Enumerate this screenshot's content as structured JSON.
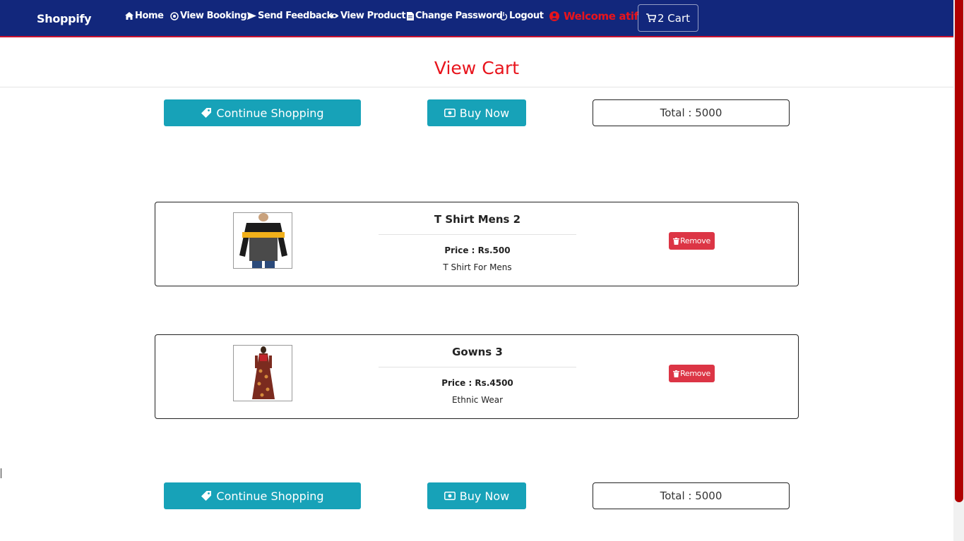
{
  "navbar": {
    "brand": "Shoppify",
    "items": [
      {
        "label": "Home",
        "icon": "home-icon"
      },
      {
        "label": "View Booking",
        "icon": "booking-icon"
      },
      {
        "label": "Send Feedback",
        "icon": "send-icon"
      },
      {
        "label": "View Product",
        "icon": "eye-icon"
      },
      {
        "label": "Change Password",
        "icon": "document-icon"
      },
      {
        "label": "Logout",
        "icon": "power-icon"
      }
    ],
    "welcome": "Welcome atif",
    "cart_label": "2 Cart"
  },
  "page": {
    "title": "View Cart"
  },
  "actions": {
    "continue_label": "Continue Shopping",
    "buy_label": "Buy Now",
    "total_label": "Total : 5000"
  },
  "cart_items": [
    {
      "name": "T Shirt Mens 2",
      "price": "Price : Rs.500",
      "description": "T Shirt For Mens",
      "remove_label": "Remove"
    },
    {
      "name": "Gowns 3",
      "price": "Price : Rs.4500",
      "description": "Ethnic Wear",
      "remove_label": "Remove"
    }
  ],
  "colors": {
    "navbar": "#12277c",
    "accent_red": "#e8141c",
    "info_button": "#17a2b8",
    "danger_button": "#dc3545",
    "scrollbar": "#b00000"
  }
}
